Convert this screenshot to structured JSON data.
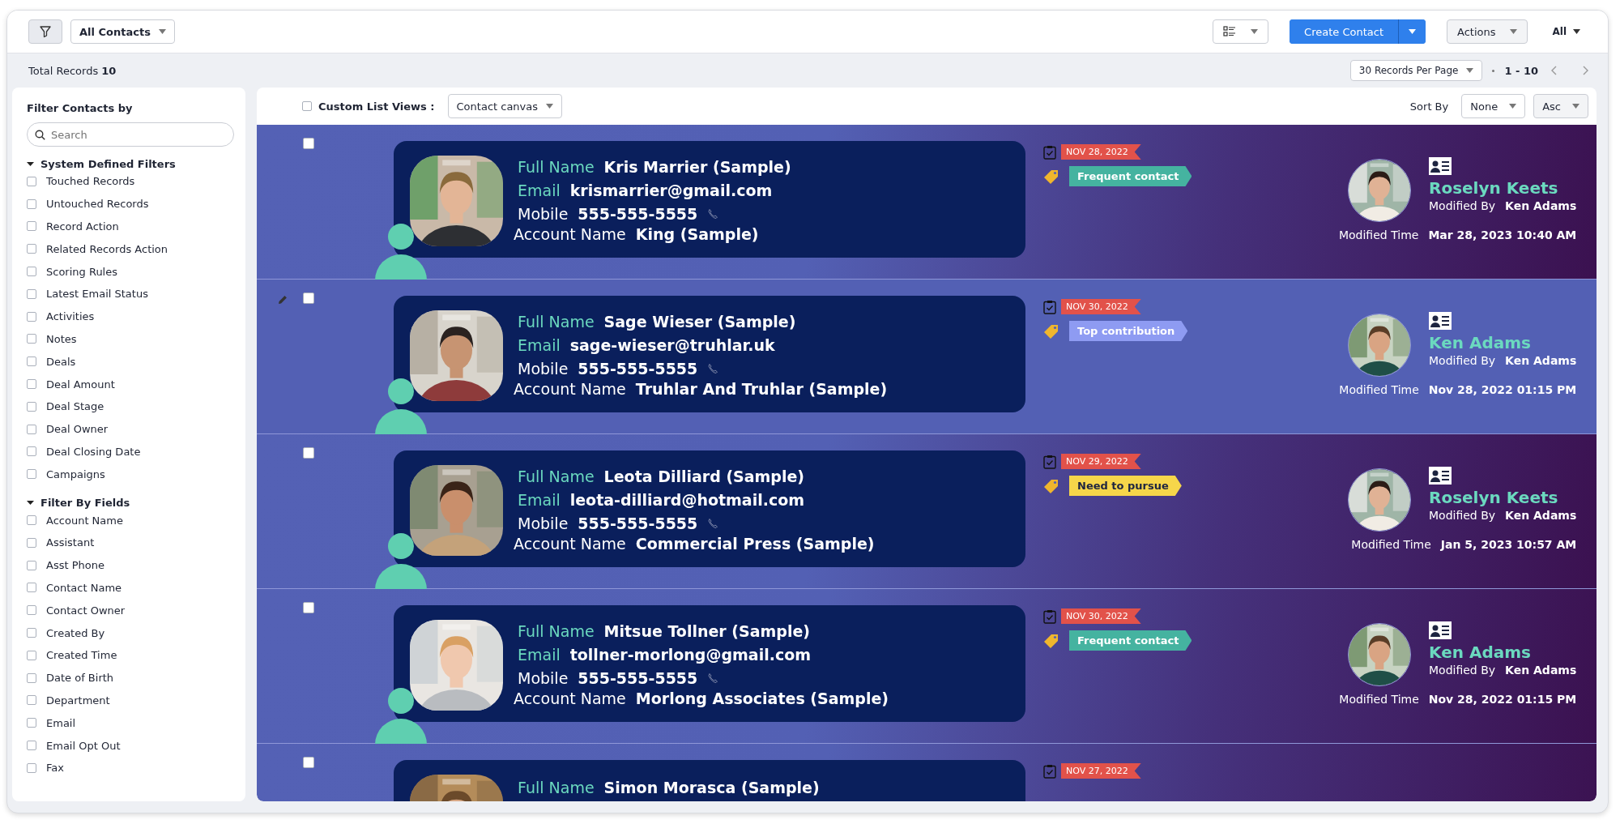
{
  "toolbar": {
    "view": "All Contacts",
    "create": "Create Contact",
    "actions": "Actions",
    "all": "All"
  },
  "summary": {
    "total": "Total Records **10**",
    "per_page": "30 Records Per Page",
    "range": "1 - 10"
  },
  "sidebar": {
    "title": "Filter Contacts by",
    "search": {
      "placeholder": "Search"
    },
    "groups": [
      {
        "label": "System Defined Filters",
        "expanded": true,
        "items": [
          {
            "label": "Touched Records",
            "checked": false
          },
          {
            "label": "Untouched Records",
            "checked": false
          },
          {
            "label": "Record Action",
            "checked": false
          },
          {
            "label": "Related Records Action",
            "checked": false
          },
          {
            "label": "Scoring Rules",
            "checked": false
          },
          {
            "label": "Latest Email Status",
            "checked": false
          },
          {
            "label": "Activities",
            "checked": false
          },
          {
            "label": "Notes",
            "checked": false
          },
          {
            "label": "Deals",
            "checked": false
          },
          {
            "label": "Deal Amount",
            "checked": false
          },
          {
            "label": "Deal Stage",
            "checked": false
          },
          {
            "label": "Deal Owner",
            "checked": false
          },
          {
            "label": "Deal Closing Date",
            "checked": false
          },
          {
            "label": "Campaigns",
            "checked": false
          }
        ]
      },
      {
        "label": "Filter By Fields",
        "expanded": true,
        "items": [
          {
            "label": "Account Name",
            "checked": false
          },
          {
            "label": "Assistant",
            "checked": false
          },
          {
            "label": "Asst Phone",
            "checked": false
          },
          {
            "label": "Contact Name",
            "checked": false
          },
          {
            "label": "Contact Owner",
            "checked": false
          },
          {
            "label": "Created By",
            "checked": false
          },
          {
            "label": "Created Time",
            "checked": false
          },
          {
            "label": "Date of Birth",
            "checked": false
          },
          {
            "label": "Department",
            "checked": false
          },
          {
            "label": "Email",
            "checked": false
          },
          {
            "label": "Email Opt Out",
            "checked": false
          },
          {
            "label": "Fax",
            "checked": false
          }
        ]
      }
    ]
  },
  "list_header": {
    "custom_views": {
      "label": "Custom List Views :",
      "checked": false
    },
    "view": "Contact canvas",
    "sort_label": "Sort By",
    "sort_field": "None",
    "sort_order": "Asc"
  },
  "records": [
    {
      "selected": false,
      "hovered": false,
      "full_name_label": "Full Name",
      "full_name": "Kris Marrier (Sample)",
      "email_label": "Email",
      "email": "krismarrier@gmail.com",
      "mobile_label": "Mobile",
      "mobile": "555-555-5555",
      "account_label": "Account Name",
      "account": "King (Sample)",
      "date": "NOV 28, 2022",
      "tag": {
        "label": "Frequent contact",
        "color": "#45b3a0"
      },
      "owner": "Roselyn Keets",
      "modified_by_label": "Modified By",
      "modified_by": "Ken Adams",
      "modified_time_label": "Modified Time",
      "modified_time": "Mar 28, 2023 10:40 AM"
    },
    {
      "selected": false,
      "hovered": true,
      "full_name_label": "Full Name",
      "full_name": "Sage Wieser (Sample)",
      "email_label": "Email",
      "email": "sage-wieser@truhlar.uk",
      "mobile_label": "Mobile",
      "mobile": "555-555-5555",
      "account_label": "Account Name",
      "account": "Truhlar And Truhlar (Sample)",
      "date": "NOV 30, 2022",
      "tag": {
        "label": "Top contribution",
        "color": "#8e9bf2"
      },
      "owner": "Ken Adams",
      "modified_by_label": "Modified By",
      "modified_by": "Ken Adams",
      "modified_time_label": "Modified Time",
      "modified_time": "Nov 28, 2022 01:15 PM"
    },
    {
      "selected": false,
      "hovered": false,
      "full_name_label": "Full Name",
      "full_name": "Leota Dilliard (Sample)",
      "email_label": "Email",
      "email": "leota-dilliard@hotmail.com",
      "mobile_label": "Mobile",
      "mobile": "555-555-5555",
      "account_label": "Account Name",
      "account": "Commercial Press (Sample)",
      "date": "NOV 29, 2022",
      "tag": {
        "label": "Need to pursue",
        "color": "#f6d64a"
      },
      "owner": "Roselyn Keets",
      "modified_by_label": "Modified By",
      "modified_by": "Ken Adams",
      "modified_time_label": "Modified Time",
      "modified_time": "Jan 5, 2023 10:57 AM"
    },
    {
      "selected": false,
      "hovered": false,
      "full_name_label": "Full Name",
      "full_name": "Mitsue Tollner (Sample)",
      "email_label": "Email",
      "email": "tollner-morlong@gmail.com",
      "mobile_label": "Mobile",
      "mobile": "555-555-5555",
      "account_label": "Account Name",
      "account": "Morlong Associates (Sample)",
      "date": "NOV 30, 2022",
      "tag": {
        "label": "Frequent contact",
        "color": "#45b3a0"
      },
      "owner": "Ken Adams",
      "modified_by_label": "Modified By",
      "modified_by": "Ken Adams",
      "modified_time_label": "Modified Time",
      "modified_time": "Nov 28, 2022 01:15 PM"
    },
    {
      "selected": false,
      "hovered": false,
      "full_name_label": "Full Name",
      "full_name": "Simon Morasca (Sample)",
      "date": "NOV 27, 2022"
    }
  ]
}
